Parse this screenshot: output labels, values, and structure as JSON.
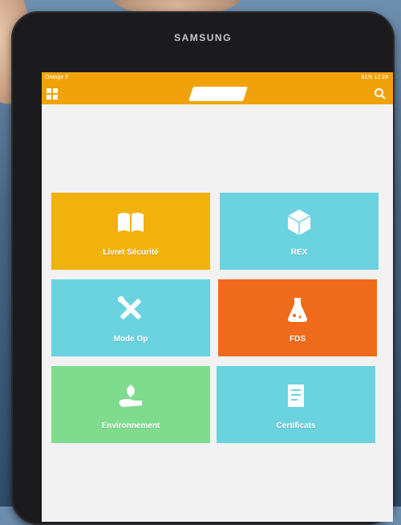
{
  "device": {
    "brand": "SAMSUNG"
  },
  "status_bar": {
    "carrier": "Orange F",
    "right": "81% 12:24"
  },
  "app_bar": {
    "logo_text": "",
    "menu_icon": "grid-menu-icon",
    "search_icon": "search-icon"
  },
  "tiles": [
    {
      "label": "Livret Sécurité",
      "icon": "book-icon",
      "color": "#f1b20d"
    },
    {
      "label": "REX",
      "icon": "cube-icon",
      "color": "#6bd3df"
    },
    {
      "label": "Mode Op",
      "icon": "tools-icon",
      "color": "#6bd3df"
    },
    {
      "label": "FDS",
      "icon": "flask-icon",
      "color": "#ef6b1c"
    },
    {
      "label": "Environnement",
      "icon": "leaf-hand-icon",
      "color": "#7fdc8f"
    },
    {
      "label": "Certificats",
      "icon": "certificate-icon",
      "color": "#6bd3df"
    }
  ]
}
